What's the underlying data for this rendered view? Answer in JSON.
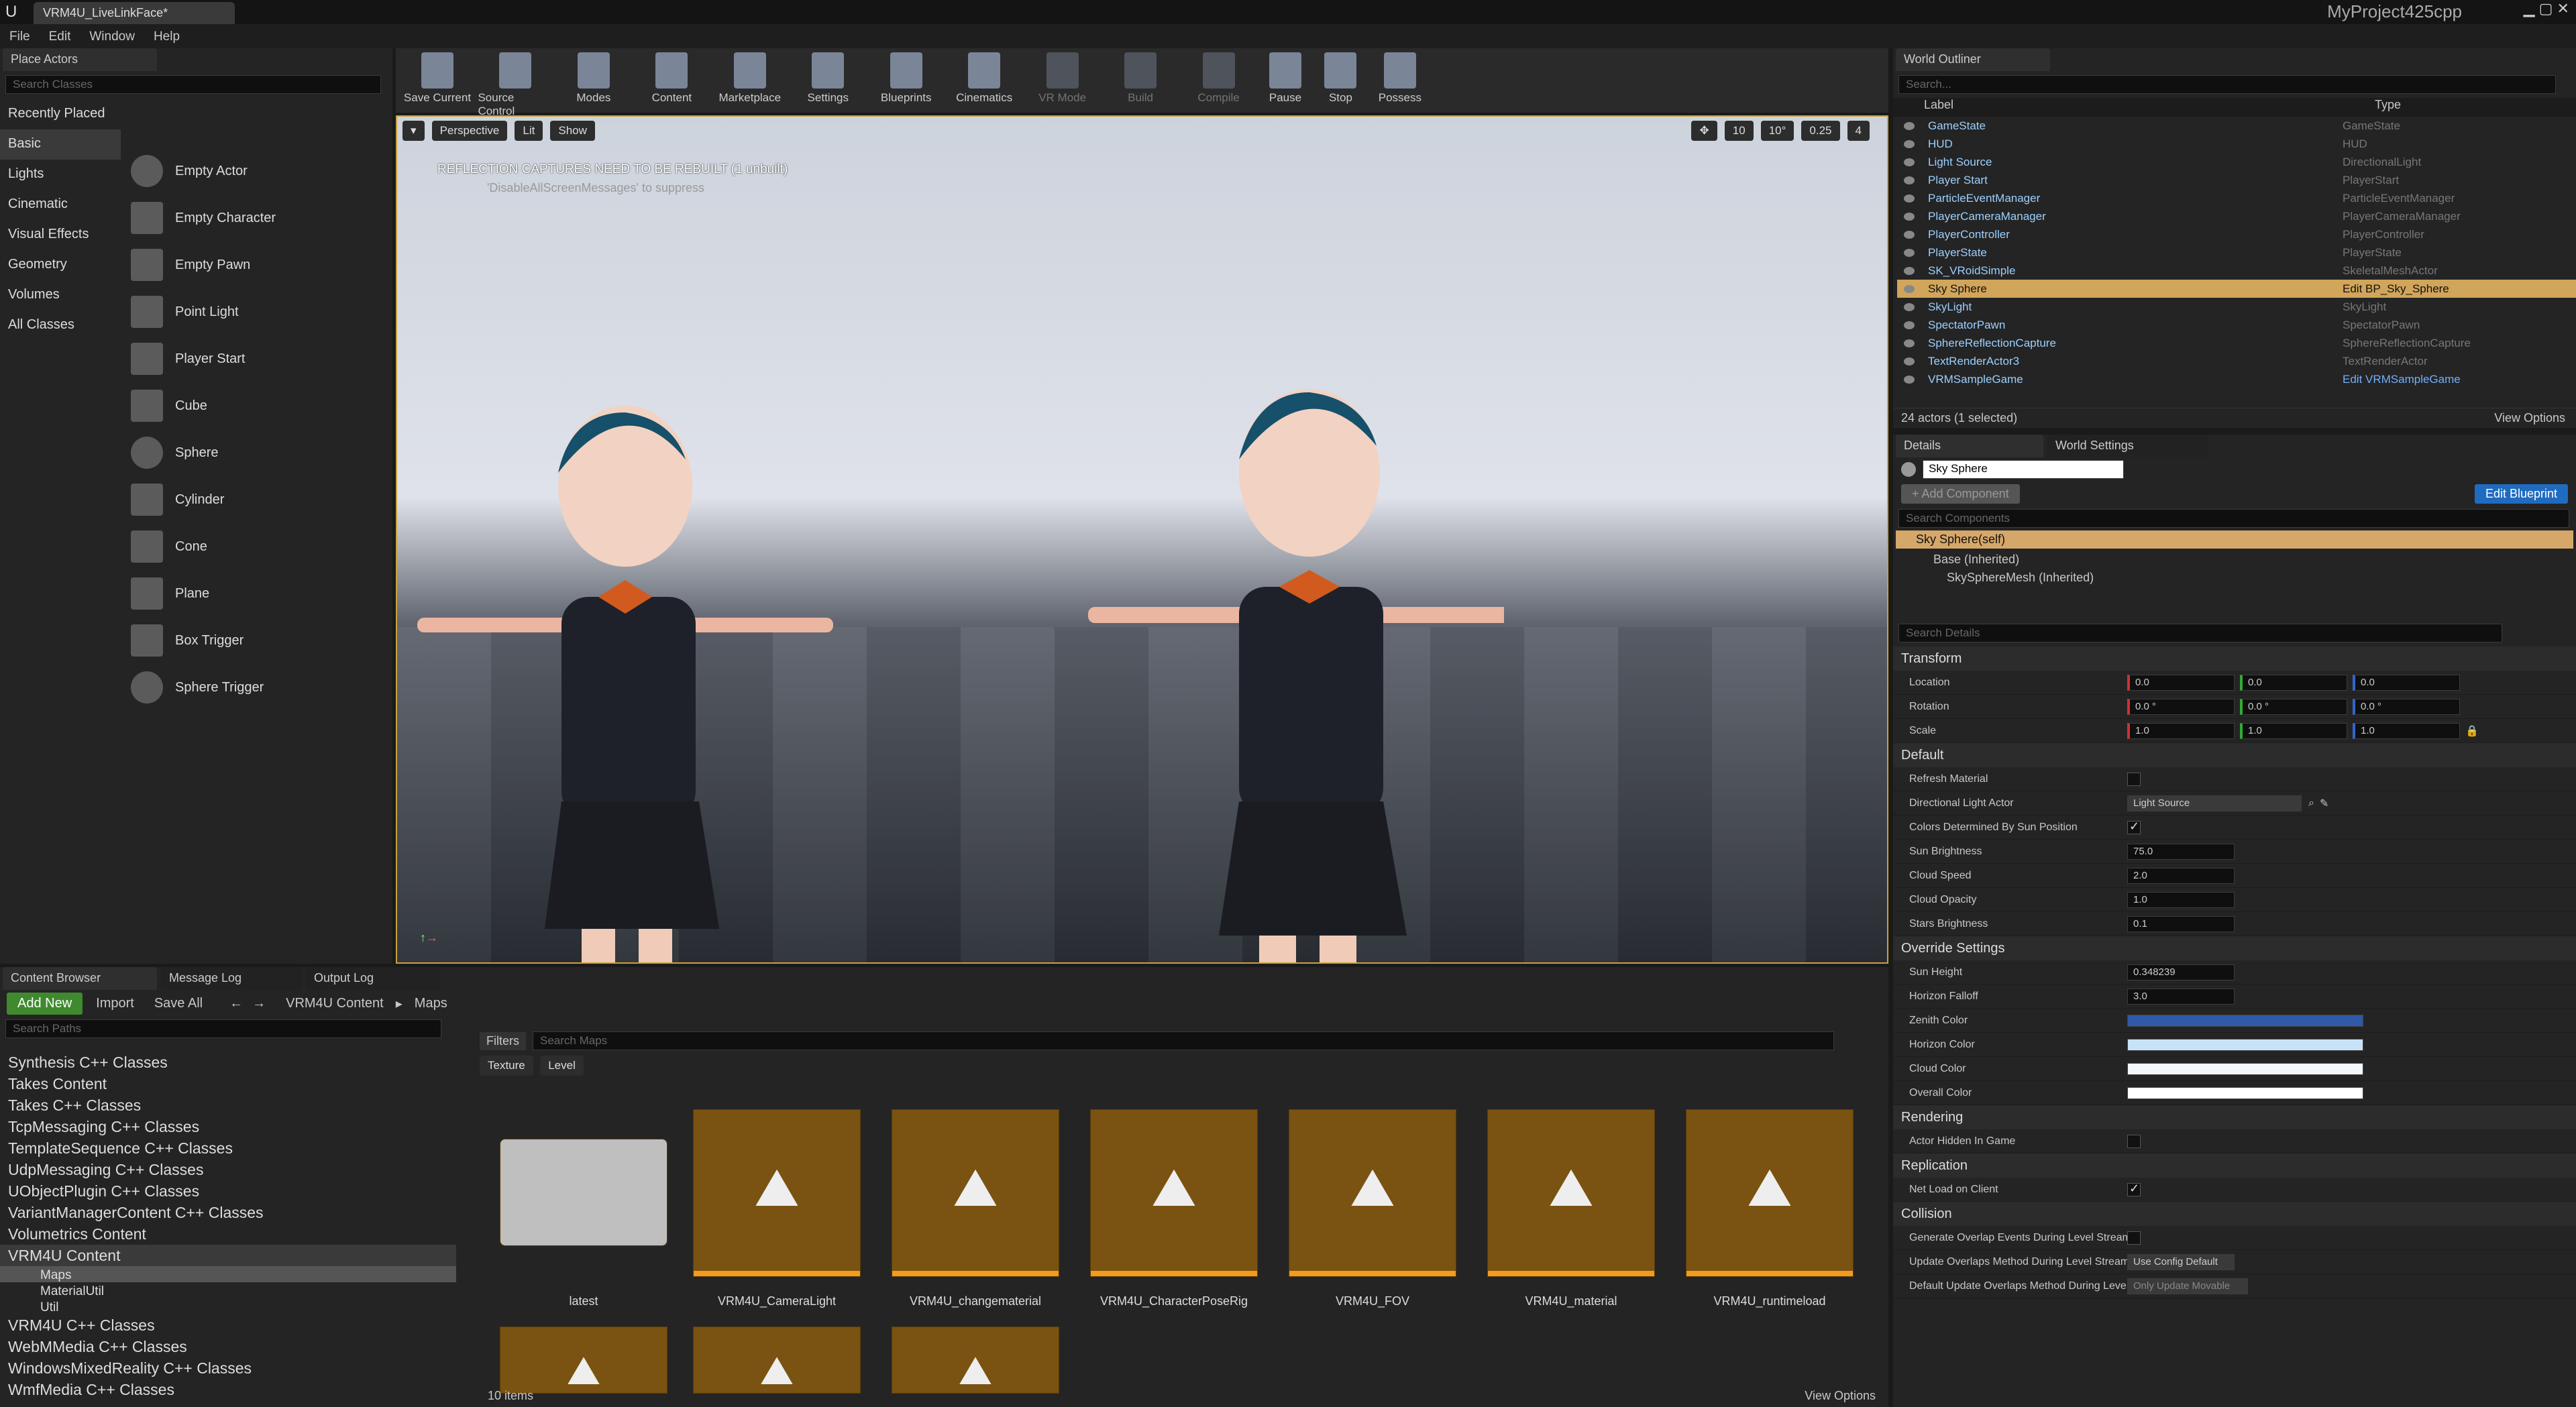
{
  "window": {
    "tab_title": "VRM4U_LiveLinkFace*",
    "project": "MyProject425cpp"
  },
  "menu": [
    "File",
    "Edit",
    "Window",
    "Help"
  ],
  "place_actors": {
    "title": "Place Actors",
    "search_placeholder": "Search Classes",
    "categories": [
      "Recently Placed",
      "Basic",
      "Lights",
      "Cinematic",
      "Visual Effects",
      "Geometry",
      "Volumes",
      "All Classes"
    ],
    "items": [
      "Empty Actor",
      "Empty Character",
      "Empty Pawn",
      "Point Light",
      "Player Start",
      "Cube",
      "Sphere",
      "Cylinder",
      "Cone",
      "Plane",
      "Box Trigger",
      "Sphere Trigger"
    ]
  },
  "toolbar": [
    "Save Current",
    "Source Control",
    "Modes",
    "Content",
    "Marketplace",
    "Settings",
    "Blueprints",
    "Cinematics",
    "VR Mode",
    "Build",
    "Compile",
    "Pause",
    "Stop",
    "Possess"
  ],
  "viewport": {
    "perspective": "Perspective",
    "lit": "Lit",
    "show": "Show",
    "warning": "REFLECTION CAPTURES NEED TO BE REBUILT (1 unbuilt)",
    "warning_sub": "'DisableAllScreenMessages' to suppress",
    "grid": "10",
    "angle": "10°",
    "scale": "0.25",
    "cam": "4"
  },
  "outliner": {
    "title": "World Outliner",
    "search_placeholder": "Search...",
    "col_label": "Label",
    "col_type": "Type",
    "rows": [
      [
        "GameState",
        "GameState"
      ],
      [
        "HUD",
        "HUD"
      ],
      [
        "Light Source",
        "DirectionalLight"
      ],
      [
        "Player Start",
        "PlayerStart"
      ],
      [
        "ParticleEventManager",
        "ParticleEventManager"
      ],
      [
        "PlayerCameraManager",
        "PlayerCameraManager"
      ],
      [
        "PlayerController",
        "PlayerController"
      ],
      [
        "PlayerState",
        "PlayerState"
      ],
      [
        "SK_VRoidSimple",
        "SkeletalMeshActor"
      ],
      [
        "Sky Sphere",
        "Edit BP_Sky_Sphere"
      ],
      [
        "SkyLight",
        "SkyLight"
      ],
      [
        "SpectatorPawn",
        "SpectatorPawn"
      ],
      [
        "SphereReflectionCapture",
        "SphereReflectionCapture"
      ],
      [
        "TextRenderActor3",
        "TextRenderActor"
      ],
      [
        "VRMSampleGame",
        "Edit VRMSampleGame"
      ]
    ],
    "footer": "24 actors (1 selected)",
    "view_options": "View Options"
  },
  "details": {
    "tab": "Details",
    "tab2": "World Settings",
    "name": "Sky Sphere",
    "add_component": "+ Add Component",
    "edit_blueprint": "Edit Blueprint",
    "search_components": "Search Components",
    "self": "Sky Sphere(self)",
    "base": "Base (Inherited)",
    "mesh": "SkySphereMesh (Inherited)",
    "search_details": "Search Details",
    "transform": "Transform",
    "location": "Location",
    "rotation": "Rotation",
    "scale": "Scale",
    "loc": [
      "0.0",
      "0.0",
      "0.0"
    ],
    "rot": [
      "0.0 °",
      "0.0 °",
      "0.0 °"
    ],
    "scl": [
      "1.0",
      "1.0",
      "1.0"
    ],
    "default": "Default",
    "refresh_material": "Refresh Material",
    "dir_light": "Directional Light Actor",
    "dir_light_val": "Light Source",
    "colors_by_sun": "Colors Determined By Sun Position",
    "sun_brightness": "Sun Brightness",
    "sun_brightness_val": "75.0",
    "cloud_speed": "Cloud Speed",
    "cloud_speed_val": "2.0",
    "cloud_opacity": "Cloud Opacity",
    "cloud_opacity_val": "1.0",
    "stars": "Stars Brightness",
    "stars_val": "0.1",
    "override": "Override Settings",
    "sun_height": "Sun Height",
    "sun_height_val": "0.348239",
    "horizon_falloff": "Horizon Falloff",
    "horizon_falloff_val": "3.0",
    "zenith": "Zenith Color",
    "horizon": "Horizon Color",
    "cloud_color": "Cloud Color",
    "overall": "Overall Color",
    "rendering": "Rendering",
    "hidden": "Actor Hidden In Game",
    "replication": "Replication",
    "net_load": "Net Load on Client",
    "collision": "Collision",
    "gen_overlap": "Generate Overlap Events During Level Streami",
    "upd_overlap": "Update Overlaps Method During Level Stream",
    "upd_overlap_val": "Use Config Default",
    "def_upd": "Default Update Overlaps Method During Leve",
    "def_upd_val": "Only Update Movable",
    "colors": {
      "zenith": "#2f5aa8",
      "horizon": "#c8e3f7",
      "cloud": "#f4f8fb",
      "overall": "#ffffff"
    }
  },
  "content_browser": {
    "tabs": [
      "Content Browser",
      "Message Log",
      "Output Log"
    ],
    "add_new": "Add New",
    "import": "Import",
    "save_all": "Save All",
    "crumb1": "VRM4U Content",
    "crumb2": "Maps",
    "search_paths": "Search Paths",
    "filters": "Filters",
    "search_maps": "Search Maps",
    "filter_tags": [
      "Texture",
      "Level"
    ],
    "tree": [
      "Synthesis C++ Classes",
      "Takes Content",
      "Takes C++ Classes",
      "TcpMessaging C++ Classes",
      "TemplateSequence C++ Classes",
      "UdpMessaging C++ Classes",
      "UObjectPlugin C++ Classes",
      "VariantManagerContent C++ Classes",
      "Volumetrics Content",
      "VRM4U Content",
      "Maps",
      "MaterialUtil",
      "Util",
      "VRM4U C++ Classes",
      "WebMMedia C++ Classes",
      "WindowsMixedReality C++ Classes",
      "WmfMedia C++ Classes"
    ],
    "assets": [
      "latest",
      "VRM4U_CameraLight",
      "VRM4U_changematerial",
      "VRM4U_CharacterPoseRig",
      "VRM4U_FOV",
      "VRM4U_material",
      "VRM4U_runtimeload"
    ],
    "items_count": "10 items",
    "view_options": "View Options"
  }
}
